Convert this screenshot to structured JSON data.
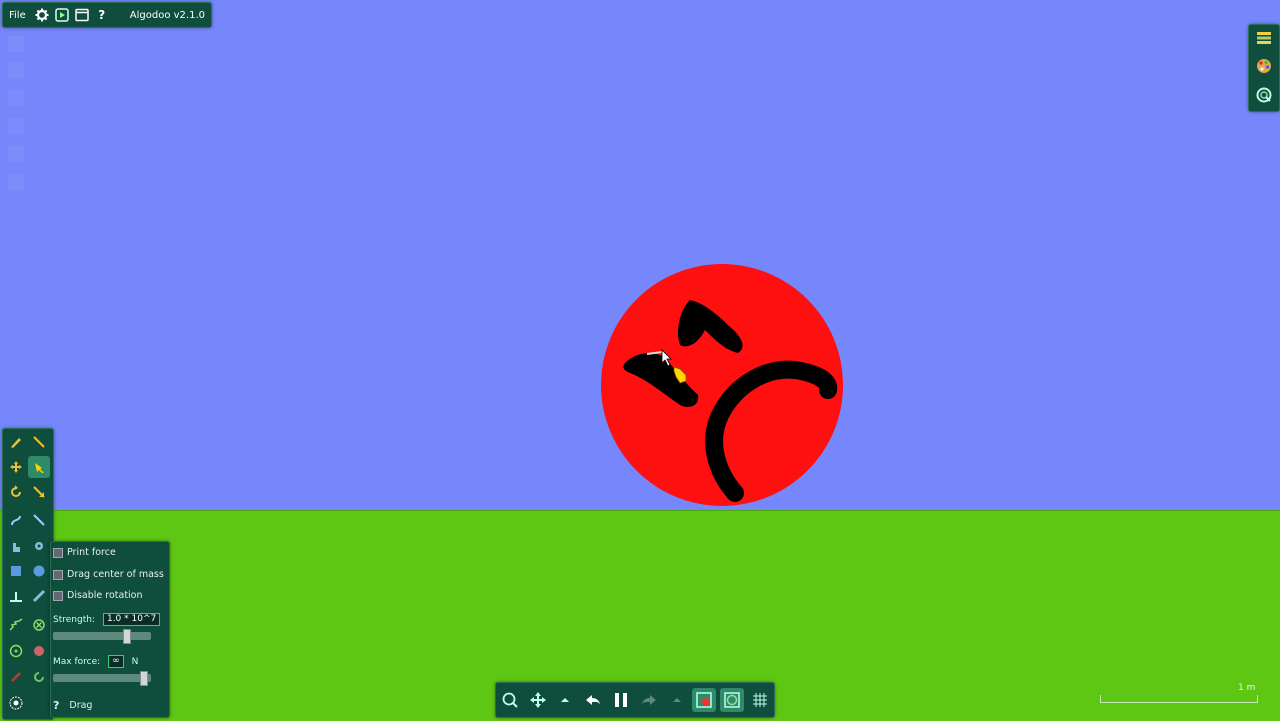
{
  "app": {
    "menu_file": "File",
    "title": "Algodoo v2.1.0"
  },
  "options": {
    "print_force": "Print force",
    "drag_center_of_mass": "Drag center of mass",
    "disable_rotation": "Disable rotation",
    "strength_label": "Strength:",
    "strength_value": "1.0 * 10^7",
    "strength_level": 0.78,
    "max_force_label": "Max force:",
    "max_force_value": "∞",
    "max_force_unit": "N",
    "max_force_level": 0.97,
    "help_glyph": "?",
    "tool_name": "Drag"
  },
  "scale": {
    "label": "1 m"
  },
  "colors": {
    "sky": "#7587fb",
    "ground": "#5ec713",
    "circle": "#ff1010",
    "panel": "#0f4d3c",
    "cursor": "#ffd400"
  },
  "icons": {
    "top": [
      "settings-icon",
      "play-icon",
      "window-icon",
      "help-icon"
    ],
    "right": [
      "layers-icon",
      "palette-icon",
      "zoom-icon"
    ],
    "bottom": [
      "zoom-icon",
      "pan-icon",
      "collapse-arrow-icon",
      "undo-icon",
      "pause-icon",
      "redo-icon",
      "expand-arrow-icon",
      "gravity-icon",
      "air-icon",
      "grid-icon"
    ]
  }
}
